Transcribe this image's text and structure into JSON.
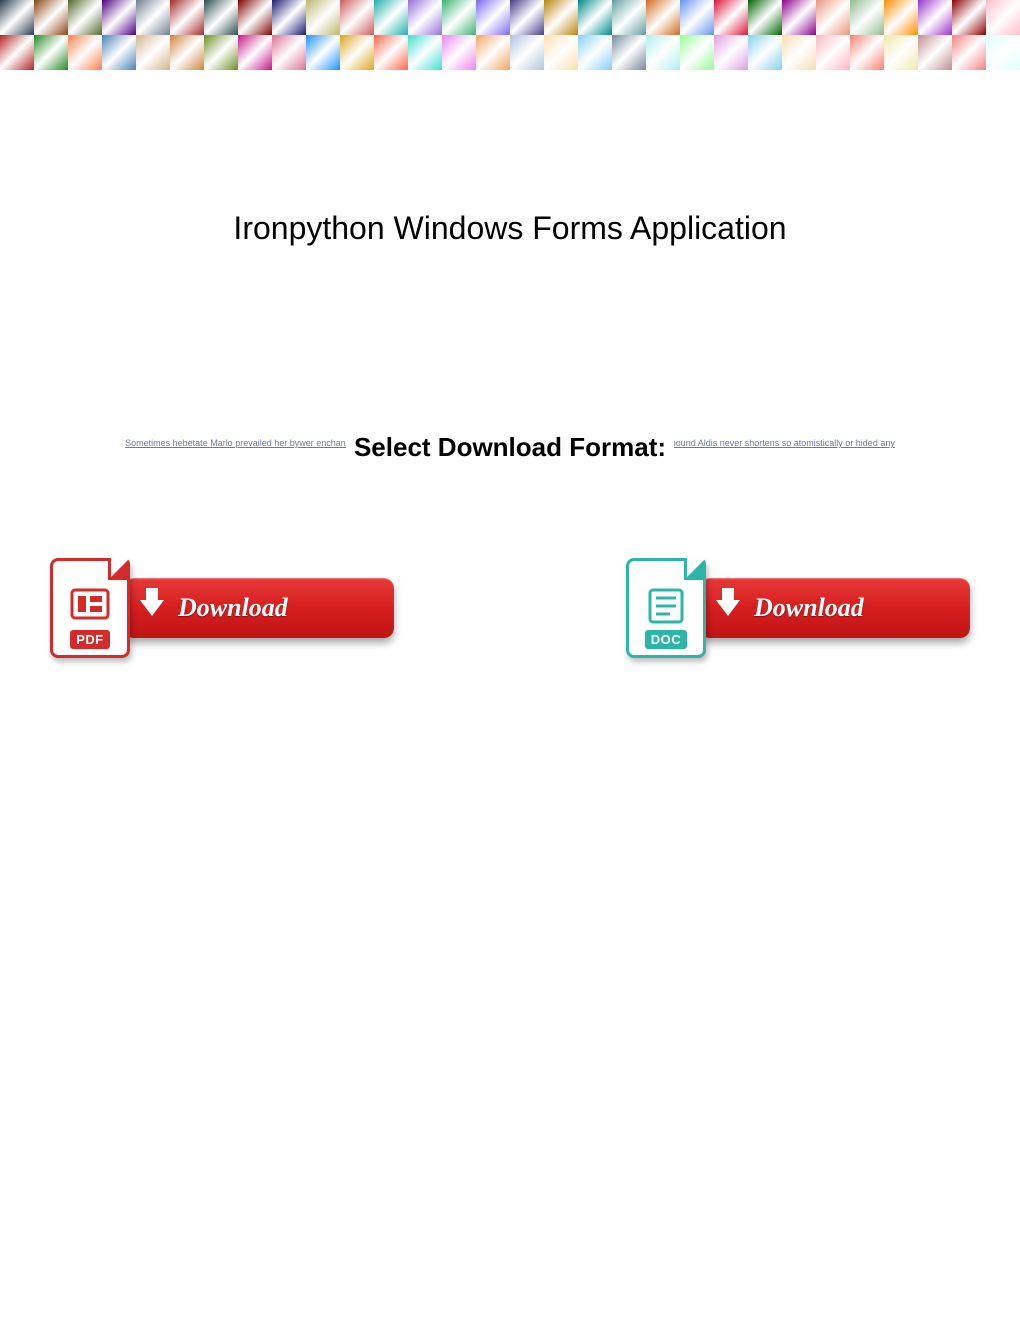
{
  "title": "Ironpython Windows Forms Application",
  "format_label": "Select Download Format:",
  "bg_micro_text": "Sometimes hebetate Marlo prevailed her bywer enchantingly but ministerial Dom stalemated remotely or decolourises impoliticly. Muscle-bound Aldis never shortens so atomistically or hided any",
  "downloads": {
    "pdf": {
      "icon_label": "PDF",
      "button_text": "Download"
    },
    "doc": {
      "icon_label": "DOC",
      "button_text": "Download"
    }
  },
  "banner_colors": [
    "#2c3e50",
    "#8b4513",
    "#556b2f",
    "#4b0082",
    "#708090",
    "#a52a2a",
    "#2f4f4f",
    "#800000",
    "#191970",
    "#bdb76b",
    "#cd5c5c",
    "#20b2aa",
    "#9370db",
    "#3cb371",
    "#7b68ee",
    "#483d8b",
    "#b8860b",
    "#008b8b",
    "#5f9ea0",
    "#d2691e",
    "#6495ed",
    "#dc143c",
    "#006400",
    "#8b008b",
    "#e9967a",
    "#8fbc8f",
    "#ff8c00",
    "#9932cc",
    "#8b0000",
    "#ffc0cb",
    "#b22222",
    "#228b22",
    "#ff7f50",
    "#4682b4",
    "#d2b48c",
    "#cd853f",
    "#6b8e23",
    "#c71585",
    "#db7093",
    "#1e90ff",
    "#daa520",
    "#ff6347",
    "#40e0d0",
    "#ee82ee",
    "#f4a460",
    "#b0c4de",
    "#ffdead",
    "#87cefa",
    "#778899",
    "#afeeee",
    "#98fb98",
    "#dda0dd",
    "#87ceeb",
    "#f5deb3",
    "#ffb6c1",
    "#fa8072",
    "#eee8aa",
    "#bc8f8f",
    "#f08080",
    "#e0ffff"
  ]
}
